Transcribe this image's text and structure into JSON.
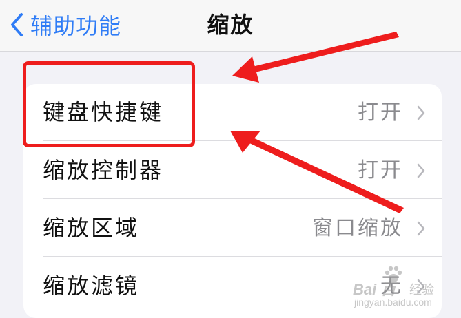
{
  "nav": {
    "back_label": "辅助功能",
    "title": "缩放"
  },
  "rows": [
    {
      "label": "键盘快捷键",
      "value": "打开"
    },
    {
      "label": "缩放控制器",
      "value": "打开"
    },
    {
      "label": "缩放区域",
      "value": "窗口缩放"
    },
    {
      "label": "缩放滤镜",
      "value": "无"
    }
  ],
  "watermark": {
    "brand": "Bai 百",
    "sub": "经验",
    "url": "jingyan.baidu.com"
  },
  "colors": {
    "accent": "#2f7cf6",
    "annotation": "#ee1d1d",
    "background": "#f2f2f7"
  },
  "icons": {
    "back": "chevron-left-icon",
    "row": "chevron-right-icon",
    "watermark": "paw-icon"
  }
}
